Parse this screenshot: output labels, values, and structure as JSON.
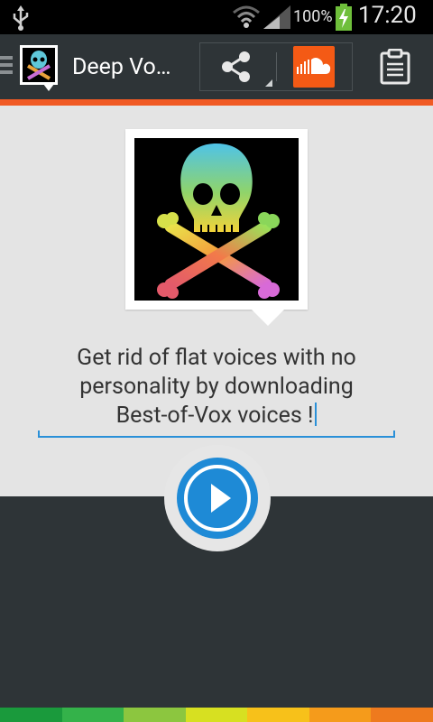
{
  "status_bar": {
    "battery_percent": "100%",
    "time": "17:20",
    "icons": [
      "usb-icon",
      "wifi-icon",
      "signal-icon",
      "battery-charging-icon"
    ]
  },
  "action_bar": {
    "title": "Deep Vo…",
    "icons": [
      "app-logo-icon",
      "share-icon",
      "soundcloud-icon",
      "clipboard-icon"
    ]
  },
  "content": {
    "description_lines": [
      "Get rid of flat voices with no",
      "personality by downloading",
      "Best-of-Vox voices !"
    ]
  },
  "colors": {
    "accent": "#f05a24",
    "primary_blue": "#1e8ad6",
    "background_dark": "#2e3437",
    "panel": "#e4e4e4",
    "soundcloud_orange": "#f45a15",
    "rainbow": [
      "#1a9a3c",
      "#34b24a",
      "#8cc63f",
      "#d7e021",
      "#f7c11a",
      "#f59b1b",
      "#ee7a1e",
      "#e8521f"
    ]
  }
}
